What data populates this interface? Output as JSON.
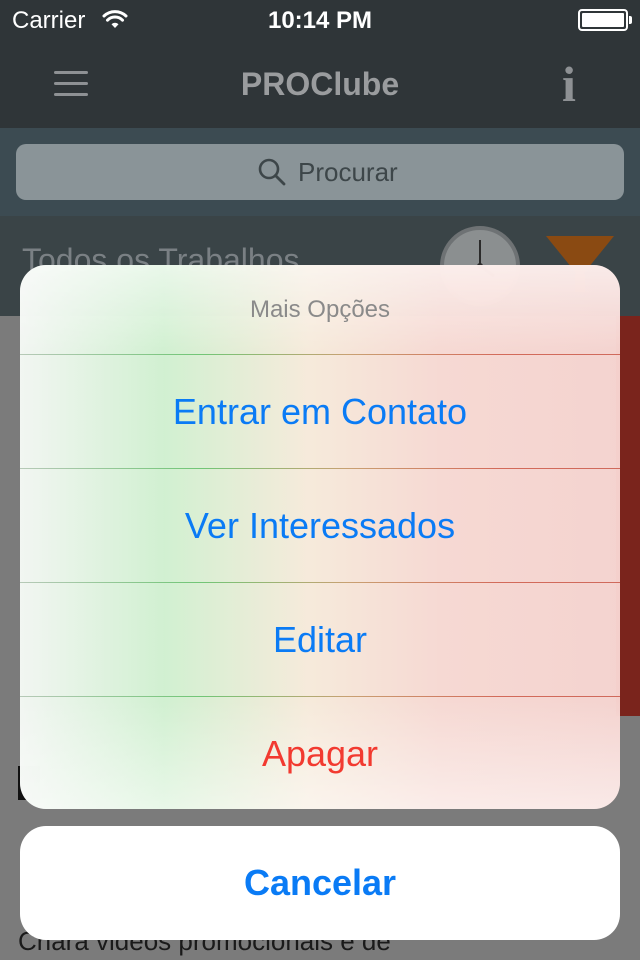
{
  "status_bar": {
    "carrier": "Carrier",
    "time": "10:14 PM",
    "wifi_icon": "wifi-icon",
    "battery_icon": "battery-icon"
  },
  "nav_bar": {
    "title": "PROClube",
    "menu_icon": "hamburger-menu-icon",
    "info_icon": "info-icon",
    "info_glyph": "i"
  },
  "search": {
    "placeholder": "Procurar",
    "icon": "search-icon"
  },
  "filter_bar": {
    "title": "Todos os Trabalhos",
    "clock_icon": "clock-icon",
    "filter_icon": "funnel-icon"
  },
  "content": {
    "job_description": "Criará videos promocionais e de"
  },
  "action_sheet": {
    "title": "Mais Opções",
    "actions": [
      {
        "label": "Entrar em Contato",
        "style": "default"
      },
      {
        "label": "Ver Interessados",
        "style": "default"
      },
      {
        "label": "Editar",
        "style": "default"
      },
      {
        "label": "Apagar",
        "style": "destructive"
      }
    ],
    "cancel_label": "Cancelar"
  },
  "colors": {
    "action_blue": "#0a7bf5",
    "destructive_red": "#f23a30",
    "nav_dark": "#2f3538",
    "search_bar_bg": "#3c4b52",
    "dim_overlay": "#7b7b7b"
  }
}
